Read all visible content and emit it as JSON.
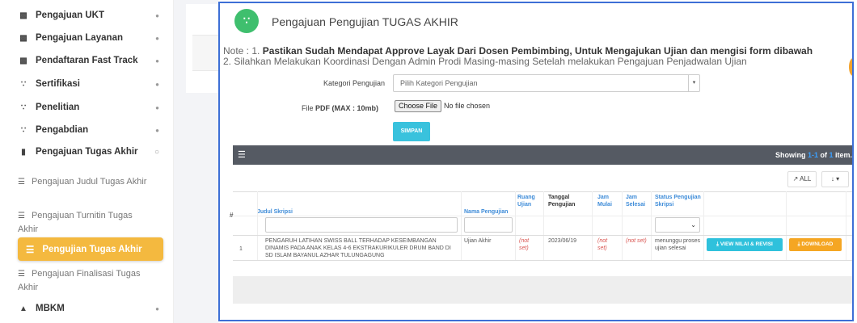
{
  "sidebar": {
    "items": [
      {
        "label": "Pengajuan UKT",
        "icon": "building-icon"
      },
      {
        "label": "Pengajuan Layanan",
        "icon": "building-icon"
      },
      {
        "label": "Pendaftaran Fast Track",
        "icon": "building-icon"
      },
      {
        "label": "Sertifikasi",
        "icon": "users-icon"
      },
      {
        "label": "Penelitian",
        "icon": "users-icon"
      },
      {
        "label": "Pengabdian",
        "icon": "users-icon"
      },
      {
        "label": "Pengajuan Tugas Akhir",
        "icon": "book-icon"
      }
    ],
    "sub_items": [
      {
        "label": "Pengajuan Judul Tugas Akhir"
      },
      {
        "label": "Pengajuan Turnitin Tugas Akhir"
      },
      {
        "label": "Pengujian Tugas Akhir"
      },
      {
        "label": "Pengajuan Finalisasi Tugas Akhir"
      }
    ],
    "mbkm": {
      "label": "MBKM",
      "icon": "graduation-cap-icon"
    },
    "active_color": "#f4b93f"
  },
  "header": {
    "title": "Pengajuan Pengujian TUGAS AKHIR",
    "icon": "users-icon",
    "icon_color": "#3fbf6e"
  },
  "note": {
    "prefix": "Note : 1. ",
    "line1_bold": "Pastikan Sudah Mendapat Approve Layak Dari Dosen Pembimbing, Untuk Mengajukan Ujian dan mengisi form dibawah",
    "line2": "2. Silahkan Melakukan Koordinasi Dengan Admin Prodi Masing-masing Setelah melakukan Pengajuan Penjadwalan Ujian"
  },
  "form": {
    "kategori_label": "Kategori Pengujian",
    "kategori_value": "Pilih Kategori Pengujian",
    "file_label_pre": "File ",
    "file_label_bold": "PDF (MAX : 10mb)",
    "file_button": "Choose File",
    "file_status": "No file chosen",
    "submit": "SIMPAN"
  },
  "table": {
    "showing_pre": "Showing ",
    "showing_range": "1-1",
    "showing_mid": " of ",
    "showing_total": "1",
    "showing_post": " item.",
    "all_button": "↗ ALL",
    "export_button": "↓ ▾",
    "columns": {
      "hash": "#",
      "judul": "Judul Skripsi",
      "nama": "Nama Pengujian",
      "ruang": "Ruang Ujian",
      "tanggal": "Tanggal Pengujian",
      "jam_mulai": "Jam Mulai",
      "jam_selesai": "Jam Selesai",
      "status": "Status Pengujian Skripsi"
    },
    "rows": [
      {
        "no": "1",
        "judul": "PENGARUH LATIHAN SWISS BALL TERHADAP KESEIMBANGAN DINAMIS PADA ANAK KELAS 4-6 EKSTRAKURIKULER DRUM BAND DI SD ISLAM BAYANUL AZHAR TULUNGAGUNG",
        "nama": "Ujian Akhir",
        "ruang": "(not set)",
        "tanggal": "2023/06/19",
        "jam_mulai": "(not set)",
        "jam_selesai": "(not set)",
        "status": "menunggu proses ujian selesai",
        "view_button": "⤓ VIEW NILAI & REVISI",
        "download_button": "⤓ DOWNLOAD"
      }
    ]
  }
}
